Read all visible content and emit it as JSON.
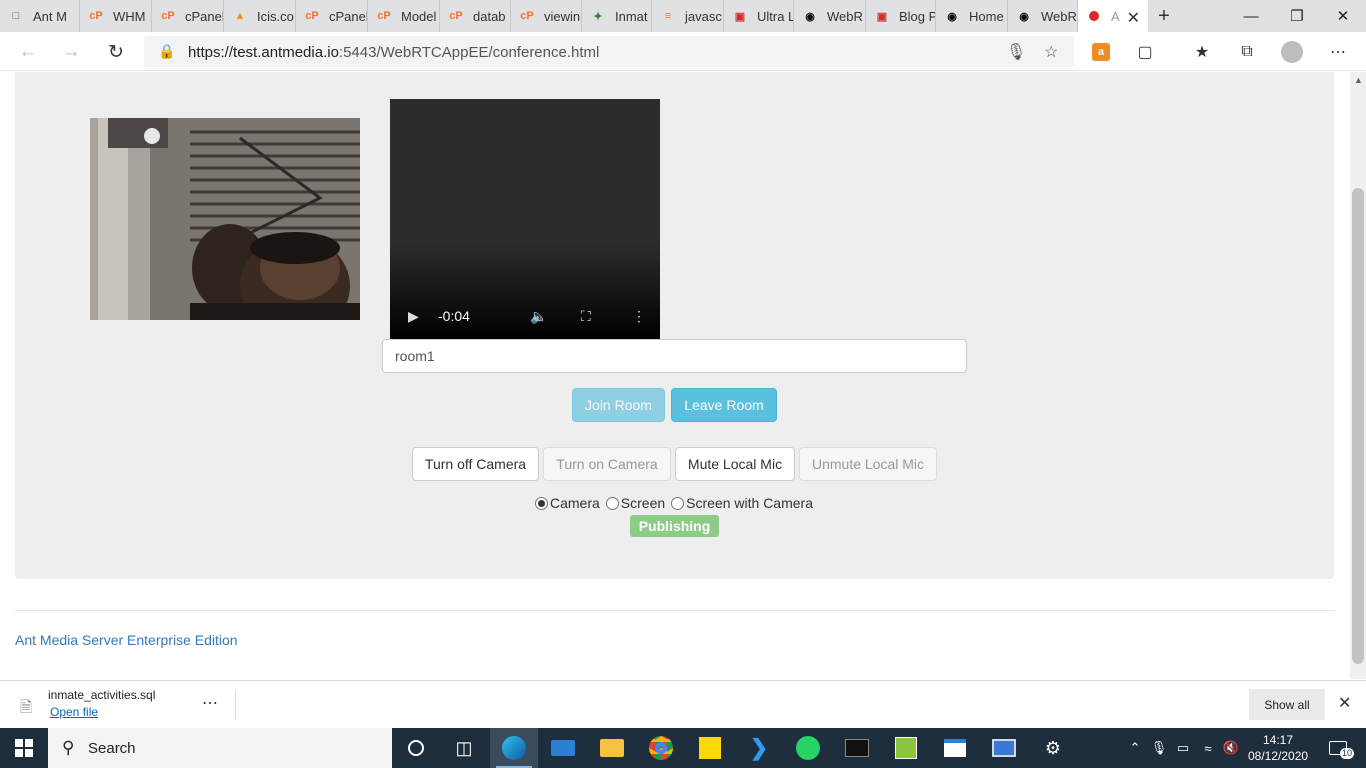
{
  "browser": {
    "tabs": [
      {
        "label": "Ant M",
        "icon": "page-icon"
      },
      {
        "label": "WHM",
        "icon": "cpanel-icon"
      },
      {
        "label": "cPanel",
        "icon": "cpanel-icon"
      },
      {
        "label": "Icis.co",
        "icon": "phpmyadmin-icon"
      },
      {
        "label": "cPanel",
        "icon": "cpanel-icon"
      },
      {
        "label": "Model",
        "icon": "cpanel-icon"
      },
      {
        "label": "datab",
        "icon": "cpanel-icon"
      },
      {
        "label": "viewin",
        "icon": "cpanel-icon"
      },
      {
        "label": "Inmat",
        "icon": "crest-icon"
      },
      {
        "label": "javasc",
        "icon": "stackoverflow-icon"
      },
      {
        "label": "Ultra L",
        "icon": "ultra-icon"
      },
      {
        "label": "WebR",
        "icon": "github-icon"
      },
      {
        "label": "Blog P",
        "icon": "ultra-icon"
      },
      {
        "label": "Home",
        "icon": "github-icon"
      },
      {
        "label": "WebR",
        "icon": "github-icon"
      },
      {
        "label": "A",
        "icon": "recording-icon",
        "active": true
      }
    ],
    "url_host": "https://test.antmedia.io",
    "url_rest": ":5443/WebRTCAppEE/conference.html"
  },
  "page": {
    "remote_video": {
      "time": "-0:04"
    },
    "room_input": {
      "value": "room1"
    },
    "buttons": {
      "join": "Join Room",
      "leave": "Leave Room",
      "turn_off_camera": "Turn off Camera",
      "turn_on_camera": "Turn on Camera",
      "mute_mic": "Mute Local Mic",
      "unmute_mic": "Unmute Local Mic"
    },
    "source_options": [
      {
        "label": "Camera",
        "checked": true
      },
      {
        "label": "Screen",
        "checked": false
      },
      {
        "label": "Screen with Camera",
        "checked": false
      }
    ],
    "status": "Publishing",
    "footer": "Ant Media Server Enterprise Edition"
  },
  "download": {
    "filename": "inmate_activities.sql",
    "open_label": "Open file",
    "show_all": "Show all"
  },
  "taskbar": {
    "search": "Search",
    "time": "14:17",
    "date": "08/12/2020",
    "notifications": "10"
  },
  "colors": {
    "panel": "#eeeeee",
    "info": "#5bc0de",
    "success": "#8ccc86",
    "link": "#337ab7",
    "taskbar": "#1f2e3d"
  }
}
